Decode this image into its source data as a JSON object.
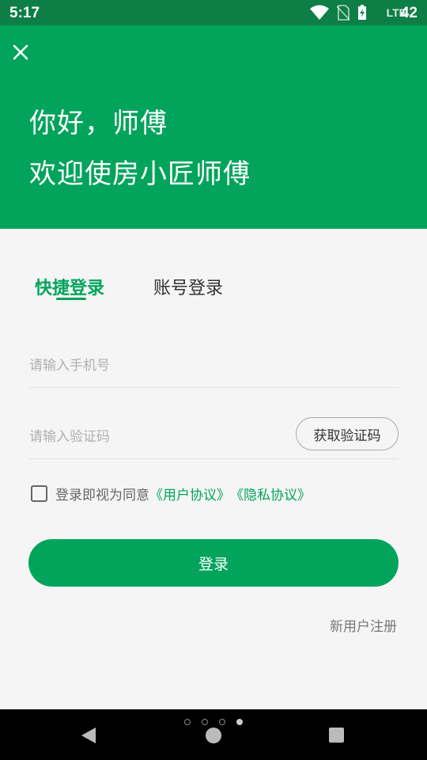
{
  "status_bar": {
    "time": "5:17",
    "network": "LTE",
    "battery": "42",
    "icons": [
      "wifi-icon",
      "no-sim-icon",
      "battery-charging-icon"
    ]
  },
  "header": {
    "close_icon": "close-icon",
    "greeting_line1": "你好，师傅",
    "greeting_line2": "欢迎使房小匠师傅"
  },
  "tabs": {
    "quick_login": "快捷登录",
    "account_login": "账号登录",
    "active": "quick_login"
  },
  "form": {
    "phone_placeholder": "请输入手机号",
    "phone_value": "",
    "code_placeholder": "请输入验证码",
    "code_value": "",
    "get_code_label": "获取验证码"
  },
  "agreement": {
    "checked": false,
    "text": "登录即视为同意",
    "user_agreement": "《用户协议》",
    "privacy_agreement": "《隐私协议》"
  },
  "login_label": "登录",
  "register_label": "新用户注册",
  "nav": {
    "page_dots": 4,
    "active_dot": 3,
    "icons": [
      "back-icon",
      "home-icon",
      "recents-icon"
    ]
  },
  "colors": {
    "brand": "#02a45c",
    "status_bar": "#0d7e45",
    "background": "#f5f5f5"
  }
}
